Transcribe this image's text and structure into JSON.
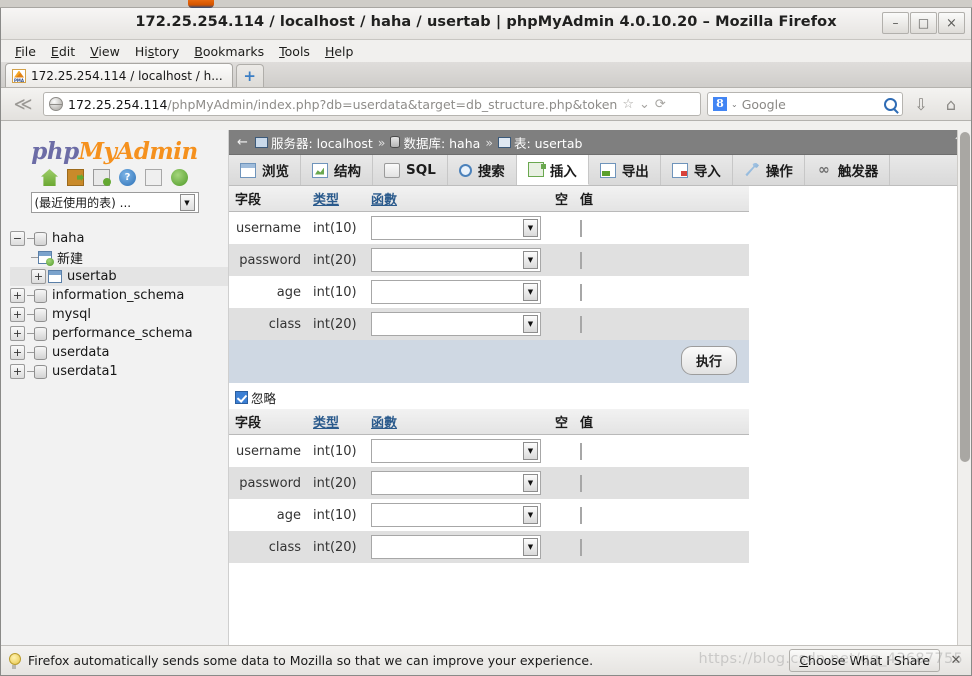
{
  "window": {
    "title": "172.25.254.114 / localhost / haha / usertab | phpMyAdmin 4.0.10.20 – Mozilla Firefox",
    "minimize": "–",
    "maximize": "□",
    "close": "×"
  },
  "menubar": [
    {
      "label": "File",
      "accel": "F"
    },
    {
      "label": "Edit",
      "accel": "E"
    },
    {
      "label": "View",
      "accel": "V"
    },
    {
      "label": "History",
      "accel": "s"
    },
    {
      "label": "Bookmarks",
      "accel": "B"
    },
    {
      "label": "Tools",
      "accel": "T"
    },
    {
      "label": "Help",
      "accel": "H"
    }
  ],
  "tabstrip": {
    "tab_title": "172.25.254.114 / localhost / h...",
    "newtab_label": "+",
    "favicon_name": "phpmyadmin-favicon"
  },
  "navbar": {
    "back_glyph": "≪",
    "url_host": "172.25.254.114",
    "url_path": "/phpMyAdmin/index.php?db=userdata&target=db_structure.php&token",
    "star_glyph": "☆",
    "dropdown_glyph": "⌄",
    "reload_glyph": "⟳",
    "search_engine": "Google",
    "search_placeholder": "Google",
    "download_glyph": "⇩",
    "home_glyph": "⌂"
  },
  "sidebar": {
    "logo_part1": "php",
    "logo_part2": "MyAdmin",
    "icons": [
      "home-icon",
      "exit-icon",
      "docs-icon",
      "help-icon",
      "copy-icon",
      "reload-icon"
    ],
    "recent_select_label": "(最近使用的表) ...",
    "tree": [
      {
        "label": "haha",
        "type": "database",
        "toggle": "−",
        "level": 0,
        "selected": false
      },
      {
        "label": "新建",
        "type": "new-table",
        "toggle": "",
        "level": 1,
        "selected": false
      },
      {
        "label": "usertab",
        "type": "table",
        "toggle": "+",
        "level": 1,
        "selected": true
      },
      {
        "label": "information_schema",
        "type": "database",
        "toggle": "+",
        "level": 0,
        "selected": false
      },
      {
        "label": "mysql",
        "type": "database",
        "toggle": "+",
        "level": 0,
        "selected": false
      },
      {
        "label": "performance_schema",
        "type": "database",
        "toggle": "+",
        "level": 0,
        "selected": false
      },
      {
        "label": "userdata",
        "type": "database",
        "toggle": "+",
        "level": 0,
        "selected": false
      },
      {
        "label": "userdata1",
        "type": "database",
        "toggle": "+",
        "level": 0,
        "selected": false
      }
    ]
  },
  "breadcrumb": {
    "back_glyph": "←",
    "server_label": "服务器: localhost",
    "sep": "»",
    "database_label": "数据库: haha",
    "table_label": "表: usertab",
    "collapse_glyph": "↑"
  },
  "pma_tabs": [
    {
      "label": "浏览",
      "icon": "browse-icon",
      "active": false
    },
    {
      "label": "结构",
      "icon": "structure-icon",
      "active": false
    },
    {
      "label": "SQL",
      "icon": "sql-icon",
      "active": false
    },
    {
      "label": "搜索",
      "icon": "search-icon",
      "active": false
    },
    {
      "label": "插入",
      "icon": "insert-icon",
      "active": true
    },
    {
      "label": "导出",
      "icon": "export-icon",
      "active": false
    },
    {
      "label": "导入",
      "icon": "import-icon",
      "active": false
    },
    {
      "label": "操作",
      "icon": "operations-icon",
      "active": false
    },
    {
      "label": "触发器",
      "icon": "triggers-icon",
      "active": false
    }
  ],
  "insert_form": {
    "headers": {
      "field": "字段",
      "type": "类型",
      "function": "函數",
      "null": "空",
      "value": "值"
    },
    "submit_label": "执行",
    "ignore_label": "忽略",
    "ignore_checked": true,
    "rows": [
      {
        "field": "username",
        "type": "int(10)",
        "function": "",
        "value": "",
        "value_width": "small"
      },
      {
        "field": "password",
        "type": "int(20)",
        "function": "",
        "value": "",
        "value_width": "wide"
      },
      {
        "field": "age",
        "type": "int(10)",
        "function": "",
        "value": "",
        "value_width": "small"
      },
      {
        "field": "class",
        "type": "int(20)",
        "function": "",
        "value": "",
        "value_width": "wide"
      }
    ]
  },
  "statusbar": {
    "message": "Firefox automatically sends some data to Mozilla so that we can improve your experience.",
    "button_accel": "C",
    "button_rest": "hoose What I Share",
    "close_glyph": "✕"
  },
  "watermark": "https://blog.csdn.net/qq_43687755"
}
